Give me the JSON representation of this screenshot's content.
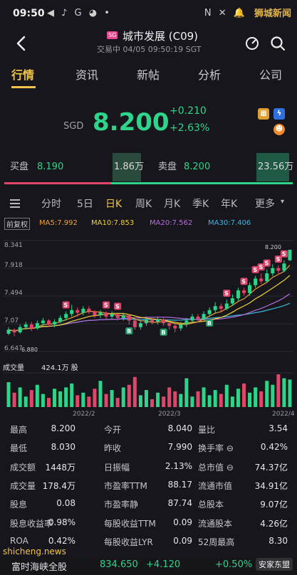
{
  "status_bar": {
    "time": "09:50",
    "left_icons": "◀ ♪ G ◕ •",
    "right_icons": "N ✕ 🔔",
    "watermark": "狮城新闻"
  },
  "header": {
    "badge": "SG",
    "stock_name": "城市发展 (C09)",
    "trade_status": "交易中 04/05 09:50:19 SGT"
  },
  "main_tabs": [
    "行情",
    "资讯",
    "新帖",
    "分析",
    "公司"
  ],
  "quote": {
    "currency": "SGD",
    "price": "8.200",
    "change": "+0.210",
    "change_pct": "+2.63%"
  },
  "order_book": {
    "bid_label": "买盘",
    "bid_price": "8.190",
    "bid_volume": "1.86万",
    "ask_label": "卖盘",
    "ask_price": "8.200",
    "ask_volume": "23.56万"
  },
  "chart_tabs": [
    "分时",
    "5日",
    "日K",
    "周K",
    "月K",
    "季K",
    "年K",
    "更多"
  ],
  "ma_legend": {
    "adjust_label": "前复权",
    "ma5": "MA5:7.992",
    "ma10": "MA10:7.853",
    "ma20": "MA20:7.562",
    "ma30": "MA30:7.406"
  },
  "colors": {
    "up_red": "#e2456a",
    "down_green": "#2fd48a",
    "accent_gold": "#f0c44a",
    "ma5": "#f0a23a",
    "ma10": "#f0d23a",
    "ma20": "#b66ee0",
    "ma30": "#3ab9e0"
  },
  "chart_data": {
    "type": "candlestick",
    "y_ticks": [
      "8.341",
      "7.918",
      "7.494",
      "7.07",
      "6.647"
    ],
    "price_labels": [
      "8.200",
      "6.880"
    ],
    "x_ticks": [
      "2022/2",
      "2022/3",
      "2022/4"
    ],
    "volume_label": "成交量",
    "volume_value": "424.1万 股",
    "candles": [
      {
        "o": 6.92,
        "c": 6.98,
        "h": 7.02,
        "l": 6.9
      },
      {
        "o": 6.98,
        "c": 6.94,
        "h": 7.0,
        "l": 6.88
      },
      {
        "o": 6.94,
        "c": 7.02,
        "h": 7.06,
        "l": 6.92
      },
      {
        "o": 7.02,
        "c": 7.06,
        "h": 7.1,
        "l": 6.98
      },
      {
        "o": 7.06,
        "c": 7.0,
        "h": 7.1,
        "l": 6.96
      },
      {
        "o": 7.0,
        "c": 7.08,
        "h": 7.12,
        "l": 6.98
      },
      {
        "o": 7.08,
        "c": 7.12,
        "h": 7.16,
        "l": 7.04
      },
      {
        "o": 7.12,
        "c": 7.06,
        "h": 7.14,
        "l": 7.02
      },
      {
        "o": 7.06,
        "c": 7.1,
        "h": 7.14,
        "l": 7.02
      },
      {
        "o": 7.1,
        "c": 7.16,
        "h": 7.2,
        "l": 7.08
      },
      {
        "o": 7.16,
        "c": 7.22,
        "h": 7.26,
        "l": 7.12
      },
      {
        "o": 7.22,
        "c": 7.28,
        "h": 7.36,
        "l": 7.18
      },
      {
        "o": 7.28,
        "c": 7.24,
        "h": 7.32,
        "l": 7.18
      },
      {
        "o": 7.24,
        "c": 7.3,
        "h": 7.34,
        "l": 7.2
      },
      {
        "o": 7.3,
        "c": 7.26,
        "h": 7.34,
        "l": 7.22
      },
      {
        "o": 7.26,
        "c": 7.2,
        "h": 7.28,
        "l": 7.16
      },
      {
        "o": 7.2,
        "c": 7.24,
        "h": 7.28,
        "l": 7.16
      },
      {
        "o": 7.24,
        "c": 7.18,
        "h": 7.26,
        "l": 7.14
      },
      {
        "o": 7.18,
        "c": 7.22,
        "h": 7.26,
        "l": 7.14
      },
      {
        "o": 7.22,
        "c": 7.16,
        "h": 7.24,
        "l": 7.12
      },
      {
        "o": 7.16,
        "c": 7.2,
        "h": 7.24,
        "l": 7.12
      },
      {
        "o": 7.2,
        "c": 7.12,
        "h": 7.22,
        "l": 7.06
      },
      {
        "o": 7.12,
        "c": 7.02,
        "h": 7.14,
        "l": 6.98
      },
      {
        "o": 7.02,
        "c": 7.08,
        "h": 7.12,
        "l": 6.98
      },
      {
        "o": 7.08,
        "c": 7.14,
        "h": 7.18,
        "l": 7.04
      },
      {
        "o": 7.14,
        "c": 7.1,
        "h": 7.18,
        "l": 7.06
      },
      {
        "o": 7.1,
        "c": 7.14,
        "h": 7.18,
        "l": 7.06
      },
      {
        "o": 7.14,
        "c": 7.08,
        "h": 7.16,
        "l": 7.04
      },
      {
        "o": 7.08,
        "c": 7.04,
        "h": 7.1,
        "l": 6.98
      },
      {
        "o": 7.04,
        "c": 7.0,
        "h": 7.06,
        "l": 6.94
      },
      {
        "o": 7.0,
        "c": 7.06,
        "h": 7.1,
        "l": 6.96
      },
      {
        "o": 7.06,
        "c": 7.12,
        "h": 7.16,
        "l": 7.02
      },
      {
        "o": 7.12,
        "c": 7.18,
        "h": 7.22,
        "l": 7.08
      },
      {
        "o": 7.18,
        "c": 7.14,
        "h": 7.22,
        "l": 7.1
      },
      {
        "o": 7.14,
        "c": 7.22,
        "h": 7.26,
        "l": 7.12
      },
      {
        "o": 7.22,
        "c": 7.28,
        "h": 7.32,
        "l": 7.18
      },
      {
        "o": 7.28,
        "c": 7.34,
        "h": 7.4,
        "l": 7.24
      },
      {
        "o": 7.34,
        "c": 7.3,
        "h": 7.38,
        "l": 7.26
      },
      {
        "o": 7.3,
        "c": 7.38,
        "h": 7.44,
        "l": 7.28
      },
      {
        "o": 7.38,
        "c": 7.46,
        "h": 7.52,
        "l": 7.34
      },
      {
        "o": 7.46,
        "c": 7.58,
        "h": 7.62,
        "l": 7.42
      },
      {
        "o": 7.58,
        "c": 7.54,
        "h": 7.62,
        "l": 7.5
      },
      {
        "o": 7.54,
        "c": 7.66,
        "h": 7.7,
        "l": 7.5
      },
      {
        "o": 7.66,
        "c": 7.76,
        "h": 7.8,
        "l": 7.62
      },
      {
        "o": 7.76,
        "c": 7.72,
        "h": 7.84,
        "l": 7.68
      },
      {
        "o": 7.72,
        "c": 7.84,
        "h": 7.9,
        "l": 7.7
      },
      {
        "o": 7.84,
        "c": 7.92,
        "h": 7.98,
        "l": 7.8
      },
      {
        "o": 7.92,
        "c": 7.88,
        "h": 7.96,
        "l": 7.82
      },
      {
        "o": 7.88,
        "c": 7.99,
        "h": 8.04,
        "l": 7.86
      },
      {
        "o": 8.04,
        "c": 8.2,
        "h": 8.2,
        "l": 8.03
      }
    ],
    "volumes": [
      38,
      22,
      30,
      16,
      26,
      34,
      20,
      14,
      28,
      24,
      30,
      36,
      18,
      22,
      16,
      28,
      40,
      20,
      26,
      14,
      30,
      34,
      46,
      18,
      26,
      12,
      22,
      16,
      30,
      24,
      20,
      44,
      16,
      24,
      30,
      18,
      26,
      20,
      34,
      16,
      28,
      36,
      22,
      30,
      24,
      40,
      34,
      50,
      44,
      42
    ],
    "signals": [
      {
        "i": 10,
        "t": "S"
      },
      {
        "i": 17,
        "t": "S"
      },
      {
        "i": 19,
        "t": "S"
      },
      {
        "i": 21,
        "t": "B"
      },
      {
        "i": 27,
        "t": "B"
      },
      {
        "i": 35,
        "t": "B"
      },
      {
        "i": 38,
        "t": "S"
      },
      {
        "i": 41,
        "t": "S"
      },
      {
        "i": 43,
        "t": "S"
      },
      {
        "i": 44,
        "t": "S"
      },
      {
        "i": 45,
        "t": "S"
      },
      {
        "i": 47,
        "t": "S"
      },
      {
        "i": 48,
        "t": "S"
      }
    ],
    "y_range": [
      6.647,
      8.341
    ]
  },
  "stats": [
    [
      {
        "label": "最高",
        "value": "8.200"
      },
      {
        "label": "今开",
        "value": "8.040"
      },
      {
        "label": "量比",
        "value": "3.54"
      }
    ],
    [
      {
        "label": "最低",
        "value": "8.030"
      },
      {
        "label": "昨收",
        "value": "7.990"
      },
      {
        "label": "换手率 ⊖",
        "value": "0.42%"
      }
    ],
    [
      {
        "label": "成交额",
        "value": "1448万"
      },
      {
        "label": "日振幅",
        "value": "2.13%"
      },
      {
        "label": "总市值 ⊖",
        "value": "74.37亿"
      }
    ],
    [
      {
        "label": "成交量",
        "value": "178.4万"
      },
      {
        "label": "市盈率TTM",
        "value": "88.17"
      },
      {
        "label": "流通市值",
        "value": "34.91亿"
      }
    ],
    [
      {
        "label": "股息",
        "value": "0.08"
      },
      {
        "label": "市盈率静",
        "value": "87.74"
      },
      {
        "label": "总股本",
        "value": "9.07亿"
      }
    ],
    [
      {
        "label": "股息收益率",
        "value": "0.98%"
      },
      {
        "label": "每股收益TTM",
        "value": "0.09"
      },
      {
        "label": "流通股本",
        "value": "4.26亿"
      }
    ],
    [
      {
        "label": "ROA",
        "value": "0.42%"
      },
      {
        "label": "每股收益LYR",
        "value": "0.09"
      },
      {
        "label": "52周最高",
        "value": "8.30"
      }
    ]
  ],
  "ticker": {
    "name": "富时海峡全股",
    "value": "834.650",
    "change": "+4.120",
    "change_pct": "+0.50%"
  },
  "watermarks": {
    "url": "shicheng.news",
    "wechat": "安家东盟"
  }
}
